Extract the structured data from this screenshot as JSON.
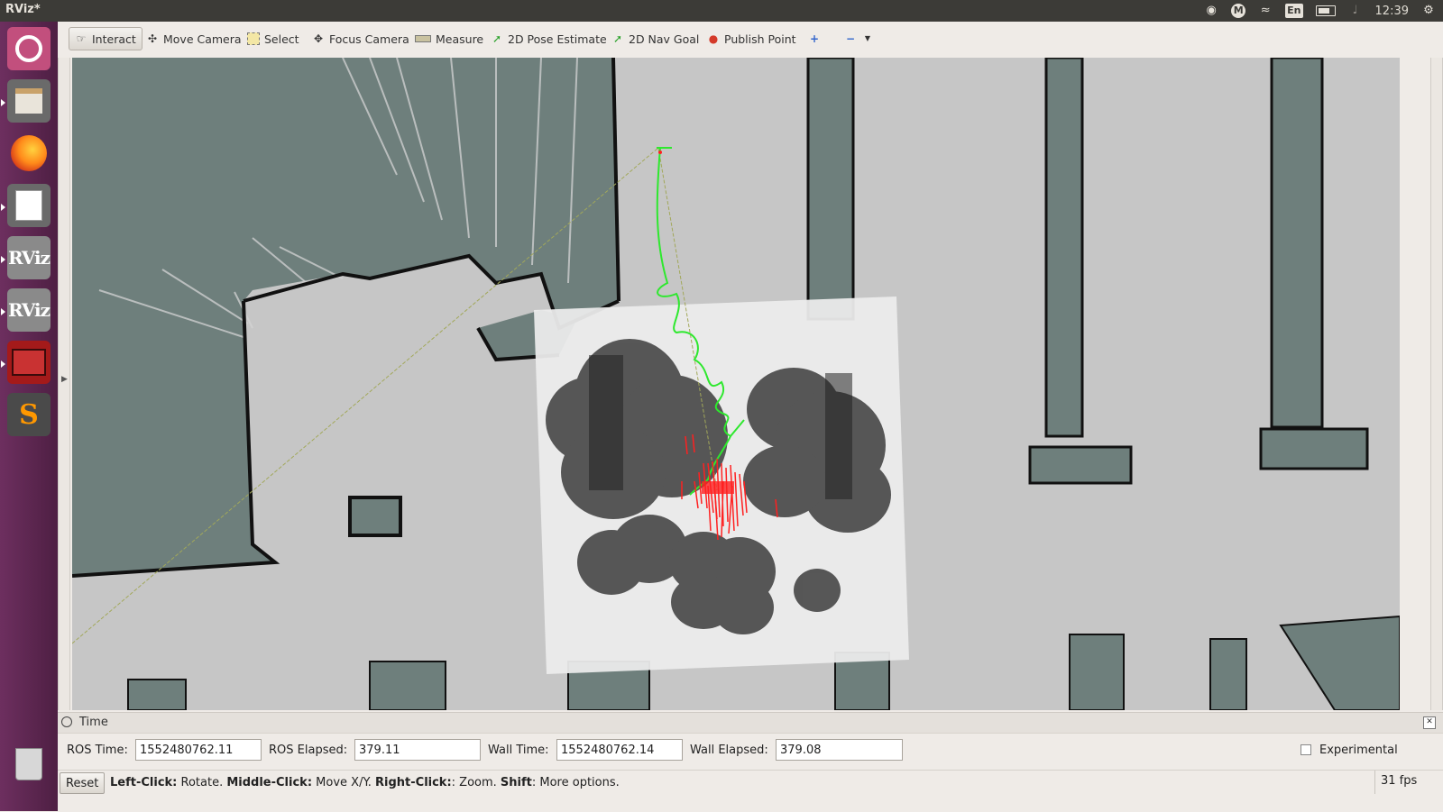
{
  "window": {
    "title": "RViz*"
  },
  "system_tray": {
    "icons": [
      "bulb-icon",
      "m-indicator-icon",
      "wifi-icon",
      "keyboard-layout-icon",
      "battery-icon",
      "volume-muted-icon",
      "settings-gear-icon"
    ],
    "keyboard_layout": "En",
    "m_label": "M",
    "clock": "12:39"
  },
  "launcher": {
    "items": [
      {
        "name": "ubuntu-dash",
        "icon": "ubuntu-logo-icon"
      },
      {
        "name": "files",
        "icon": "file-cabinet-icon"
      },
      {
        "name": "firefox",
        "icon": "firefox-icon"
      },
      {
        "name": "text-editor",
        "icon": "text-editor-icon"
      },
      {
        "name": "rviz-1",
        "icon": "rviz-icon",
        "label": "RViz"
      },
      {
        "name": "rviz-2",
        "icon": "rviz-icon",
        "label": "RViz"
      },
      {
        "name": "terminal",
        "icon": "terminal-icon"
      },
      {
        "name": "sublime-text",
        "icon": "sublime-icon",
        "label": "S"
      },
      {
        "name": "trash",
        "icon": "trash-icon"
      }
    ]
  },
  "toolbar": {
    "tools": [
      {
        "id": "interact",
        "label": "Interact",
        "icon": "hand-pointer-icon",
        "active": true
      },
      {
        "id": "move-camera",
        "label": "Move Camera",
        "icon": "move-camera-icon"
      },
      {
        "id": "select",
        "label": "Select",
        "icon": "select-box-icon"
      },
      {
        "id": "focus-camera",
        "label": "Focus Camera",
        "icon": "crosshair-icon"
      },
      {
        "id": "measure",
        "label": "Measure",
        "icon": "measuring-tape-icon"
      },
      {
        "id": "2d-pose-estimate",
        "label": "2D Pose Estimate",
        "icon": "green-arrow-icon"
      },
      {
        "id": "2d-nav-goal",
        "label": "2D Nav Goal",
        "icon": "green-arrow-icon"
      },
      {
        "id": "publish-point",
        "label": "Publish Point",
        "icon": "map-pin-icon"
      }
    ],
    "add_tool_icon": "plus-icon",
    "remove_tool_icon": "minus-icon"
  },
  "time_panel": {
    "title": "Time",
    "ros_time_label": "ROS Time:",
    "ros_time": "1552480762.11",
    "ros_elapsed_label": "ROS Elapsed:",
    "ros_elapsed": "379.11",
    "wall_time_label": "Wall Time:",
    "wall_time": "1552480762.14",
    "wall_elapsed_label": "Wall Elapsed:",
    "wall_elapsed": "379.08",
    "experimental_label": "Experimental",
    "experimental_checked": false
  },
  "status_bar": {
    "reset_label": "Reset",
    "help": [
      {
        "bold": "Left-Click:",
        "text": " Rotate. "
      },
      {
        "bold": "Middle-Click:",
        "text": " Move X/Y. "
      },
      {
        "bold": "Right-Click:",
        "text": ": Zoom. "
      },
      {
        "bold": "Shift",
        "text": ": More options."
      }
    ],
    "fps": "31 fps"
  },
  "colors": {
    "map_free": "#c6c6c6",
    "map_unknown": "#6e7f7c",
    "map_wall": "#111111",
    "costmap_bg": "#ececec",
    "costmap_obstacle": "#505050",
    "path": "#2ee82e",
    "particles": "#ff2020",
    "launcher": "#5e2750",
    "topbar": "#3c3b37"
  }
}
